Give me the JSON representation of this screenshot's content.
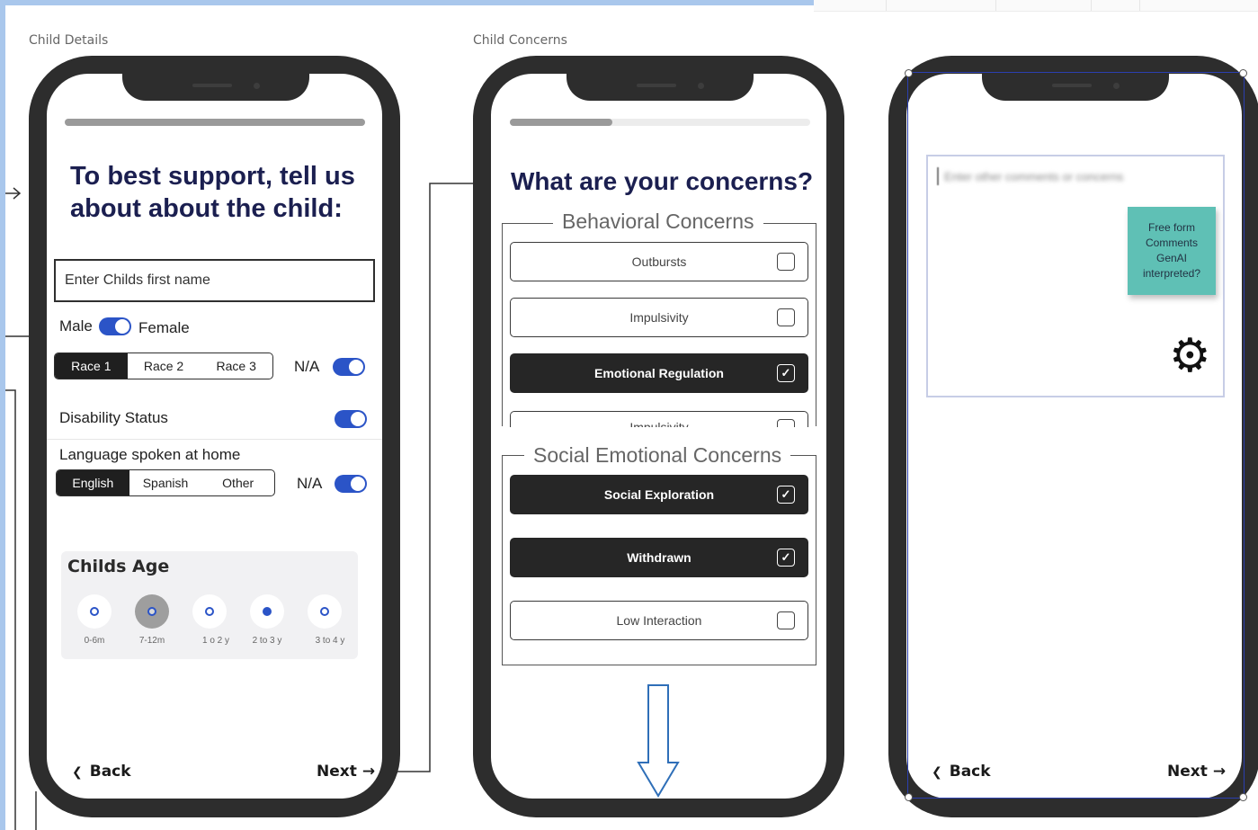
{
  "flow_labels": {
    "child_details": "Child Details",
    "child_concerns": "Child Concerns"
  },
  "screen1": {
    "progress_percent": 100,
    "heading_line1": "To best support, tell us",
    "heading_line2": "about about the child:",
    "first_name_placeholder": "Enter Childs first name",
    "gender_left": "Male",
    "gender_right": "Female",
    "race_options": [
      "Race 1",
      "Race 2",
      "Race 3"
    ],
    "race_selected": "Race 1",
    "race_na": "N/A",
    "disability_label": "Disability Status",
    "language_label": "Language spoken at home",
    "language_options": [
      "English",
      "Spanish",
      "Other"
    ],
    "language_selected": "English",
    "language_na": "N/A",
    "age_title": "Childs Age",
    "age_options": [
      "0-6m",
      "7-12m",
      "1 o 2 y",
      "2 to 3 y",
      "3 to 4 y"
    ],
    "back": "Back",
    "next": "Next",
    "arrow_left": "❮",
    "arrow_right": "→"
  },
  "screen2": {
    "progress_percent": 34,
    "heading": "What are your concerns?",
    "behavioral_title": "Behavioral Concerns",
    "behavioral_items": [
      {
        "label": "Outbursts",
        "checked": false
      },
      {
        "label": "Impulsivity",
        "checked": false
      },
      {
        "label": "Emotional Regulation",
        "checked": true
      },
      {
        "label": "Impulsivity",
        "checked": false
      }
    ],
    "social_title": "Social Emotional Concerns",
    "social_items": [
      {
        "label": "Social Exploration",
        "checked": true
      },
      {
        "label": "Withdrawn",
        "checked": true
      },
      {
        "label": "Low Interaction",
        "checked": false
      }
    ],
    "check_glyph": "✓"
  },
  "screen3": {
    "comment_placeholder": "Enter other comments or concerns",
    "sticky_note": "Free form Comments GenAI interpreted?",
    "gear_glyph": "⚙",
    "back": "Back",
    "next": "Next",
    "arrow_left": "❮",
    "arrow_right": "→"
  },
  "colors": {
    "accent_blue": "#2b54c7",
    "heading_navy": "#1b1f50",
    "phone_frame": "#2d2d2d",
    "sticky_teal": "#5fc0b5",
    "down_arrow": "#2f6fb8"
  }
}
